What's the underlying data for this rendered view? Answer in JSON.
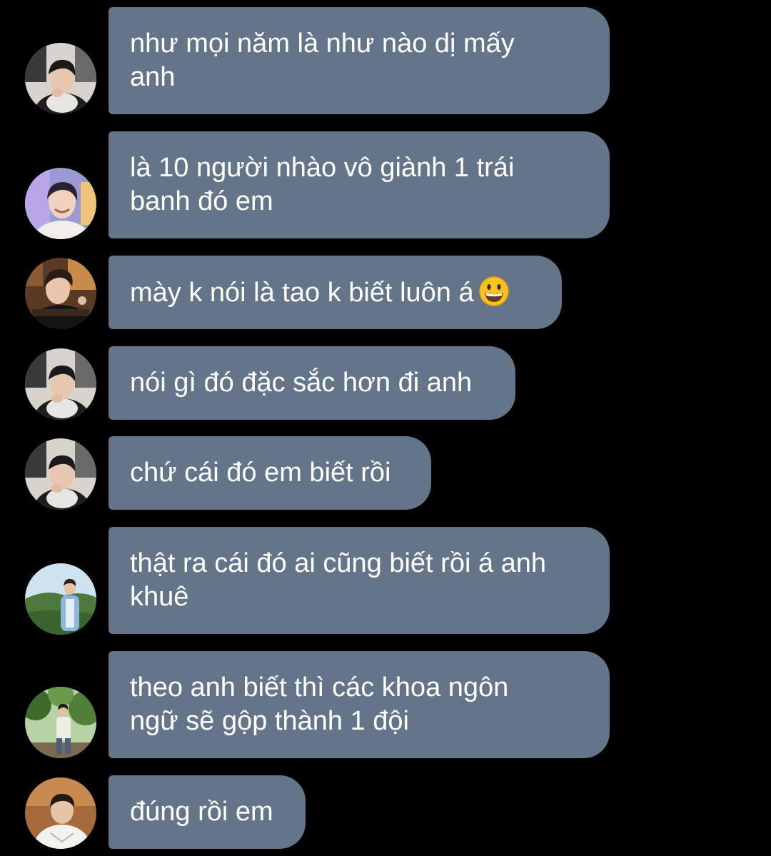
{
  "messages": [
    {
      "text": "như mọi năm là như nào dị mấy\nanh",
      "avatar": "avatar-user-a"
    },
    {
      "text": "là 10 người nhào vô giành 1 trái\nbanh đó em",
      "avatar": "avatar-user-b"
    },
    {
      "text": "mày k nói là tao k biết luôn á",
      "avatar": "avatar-user-c",
      "emoji": "grinning-face-emoji"
    },
    {
      "text": "nói gì đó đặc sắc hơn đi anh",
      "avatar": "avatar-user-a"
    },
    {
      "text": "chứ cái đó em biết rồi",
      "avatar": "avatar-user-a"
    },
    {
      "text": "thật ra cái đó ai cũng biết rồi á anh\nkhuê",
      "avatar": "avatar-user-d"
    },
    {
      "text": "theo anh biết thì các khoa ngôn\nngữ sẽ gộp thành 1 đội",
      "avatar": "avatar-user-e"
    },
    {
      "text": "đúng rồi em",
      "avatar": "avatar-user-f"
    }
  ],
  "colors": {
    "background": "#000000",
    "bubble": "#64758a",
    "text": "#ffffff"
  }
}
